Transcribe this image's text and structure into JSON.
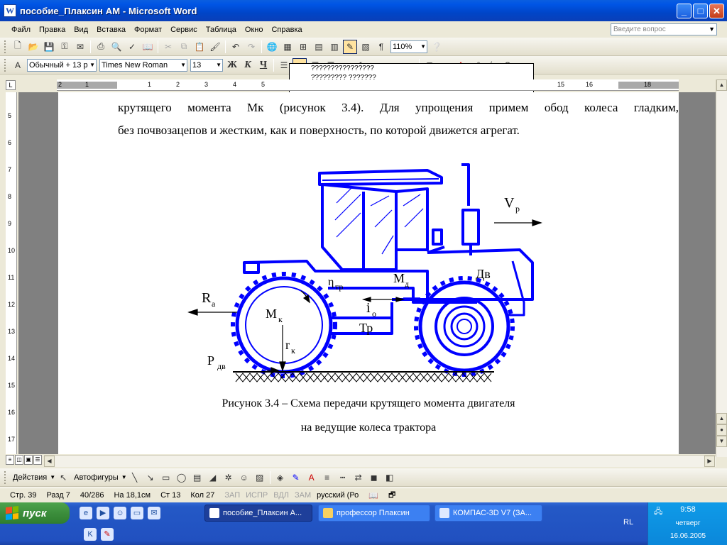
{
  "window": {
    "title": "пособие_Плаксин АМ - Microsoft Word",
    "app_icon_letter": "W"
  },
  "menu": [
    "Файл",
    "Правка",
    "Вид",
    "Вставка",
    "Формат",
    "Сервис",
    "Таблица",
    "Окно",
    "Справка"
  ],
  "ask_placeholder": "Введите вопрос",
  "toolbar": {
    "zoom": "110%",
    "style": "Обычный + 13 р",
    "font": "Times New Roman",
    "size": "13",
    "bold": "Ж",
    "italic": "К",
    "underline": "Ч"
  },
  "popup_lines": [
    "????????????????",
    "????????? ???????"
  ],
  "ruler": {
    "h_numbers": [
      "2",
      "1",
      "1",
      "2",
      "3",
      "4",
      "5",
      "15",
      "16",
      "18"
    ],
    "v_numbers": [
      "5",
      "6",
      "7",
      "8",
      "9",
      "10",
      "11",
      "12",
      "13",
      "14",
      "15",
      "16",
      "17"
    ]
  },
  "document": {
    "line1": "крутящего момента Мк (рисунок 3.4). Для упрощения примем обод колеса гладким,",
    "line2": "без почвозацепов и жестким, как и поверхность, по которой движется агрегат.",
    "caption1": "Рисунок 3.4 – Схема передачи крутящего момента двигателя",
    "caption2": "на ведущие колеса трактора"
  },
  "figure_labels": {
    "vp": "V",
    "vp_sub": "р",
    "dv": "Дв",
    "md": "М",
    "md_sub": "д",
    "eta": "η",
    "eta_sub": "тр",
    "ra": "R",
    "ra_sub": "а",
    "mk": "М",
    "mk_sub": "к",
    "io": "i",
    "io_sub": "о",
    "tr": "Тр",
    "rk": "r",
    "rk_sub": "к",
    "pdv": "Р",
    "pdv_sub": "дв"
  },
  "drawbar": {
    "actions": "Действия",
    "autoshapes": "Автофигуры"
  },
  "status": {
    "page": "Стр.  39",
    "section": "Разд  7",
    "pages": "40/286",
    "at": "На  18,1см",
    "line": "Ст  13",
    "col": "Кол  27",
    "rec": "ЗАП",
    "trk": "ИСПР",
    "ext": "ВДЛ",
    "ovr": "ЗАМ",
    "lang": "русский (Ро"
  },
  "taskbar": {
    "start": "пуск",
    "tasks": [
      "пособие_Плаксин А...",
      "профессор Плаксин",
      "КОМПАС-3D V7 (ЗА..."
    ],
    "lang": "RL",
    "time": "9:58",
    "day": "четверг",
    "date": "16.06.2005"
  },
  "colors": {
    "drawing_blue": "#0000ff",
    "titlebar": "#0055e5",
    "start_green": "#3c8e3c"
  }
}
